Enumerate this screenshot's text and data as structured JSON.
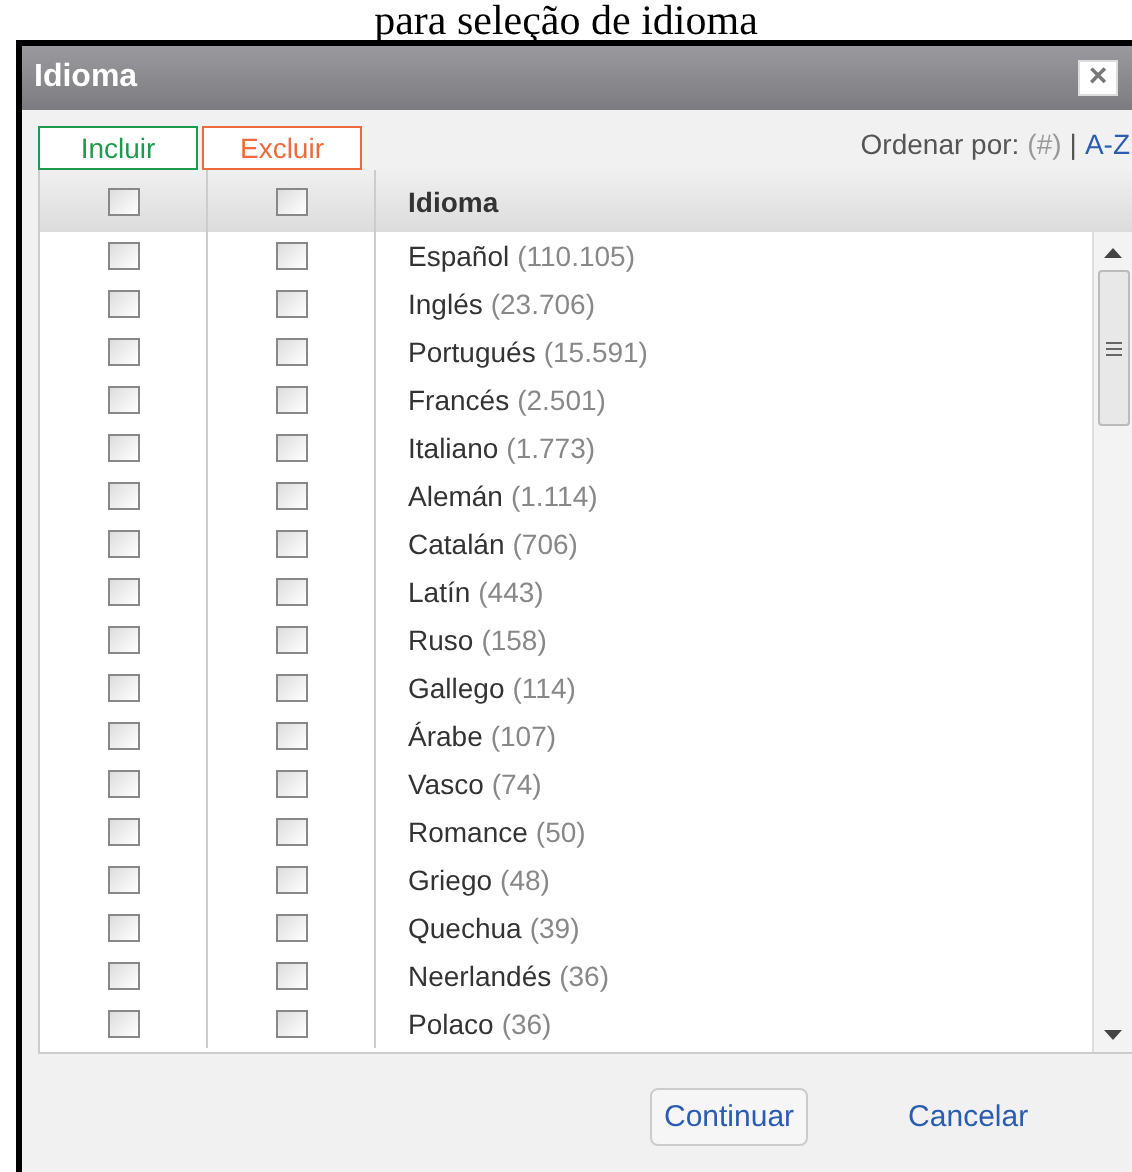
{
  "caption": "para seleção de idioma",
  "window": {
    "title": "Idioma",
    "close": "×"
  },
  "filters": [
    {
      "label": "Incluir",
      "kind": "include"
    },
    {
      "label": "Excluir",
      "kind": "exclude"
    }
  ],
  "sort": {
    "label": "Ordenar por:",
    "options": [
      {
        "label": "(#)",
        "selected": true
      },
      {
        "label": "A-Z",
        "selected": false
      }
    ],
    "separator": "|"
  },
  "table": {
    "header": {
      "include": false,
      "exclude": false,
      "label": "Idioma"
    },
    "rows": [
      {
        "name": "Español",
        "count": "(110.105)",
        "include": false,
        "exclude": false
      },
      {
        "name": "Inglés",
        "count": "(23.706)",
        "include": false,
        "exclude": false
      },
      {
        "name": "Portugués",
        "count": "(15.591)",
        "include": false,
        "exclude": false
      },
      {
        "name": "Francés",
        "count": "(2.501)",
        "include": false,
        "exclude": false
      },
      {
        "name": "Italiano",
        "count": "(1.773)",
        "include": false,
        "exclude": false
      },
      {
        "name": "Alemán",
        "count": "(1.114)",
        "include": false,
        "exclude": false
      },
      {
        "name": "Catalán",
        "count": "(706)",
        "include": false,
        "exclude": false
      },
      {
        "name": "Latín",
        "count": "(443)",
        "include": false,
        "exclude": false
      },
      {
        "name": "Ruso",
        "count": "(158)",
        "include": false,
        "exclude": false
      },
      {
        "name": "Gallego",
        "count": "(114)",
        "include": false,
        "exclude": false
      },
      {
        "name": "Árabe",
        "count": "(107)",
        "include": false,
        "exclude": false
      },
      {
        "name": "Vasco",
        "count": "(74)",
        "include": false,
        "exclude": false
      },
      {
        "name": "Romance",
        "count": "(50)",
        "include": false,
        "exclude": false
      },
      {
        "name": "Griego",
        "count": "(48)",
        "include": false,
        "exclude": false
      },
      {
        "name": "Quechua",
        "count": "(39)",
        "include": false,
        "exclude": false
      },
      {
        "name": "Neerlandés",
        "count": "(36)",
        "include": false,
        "exclude": false
      },
      {
        "name": "Polaco",
        "count": "(36)",
        "include": false,
        "exclude": false
      }
    ]
  },
  "buttons": [
    {
      "label": "Continuar",
      "kind": "button"
    },
    {
      "label": "Cancelar",
      "kind": "link"
    }
  ]
}
